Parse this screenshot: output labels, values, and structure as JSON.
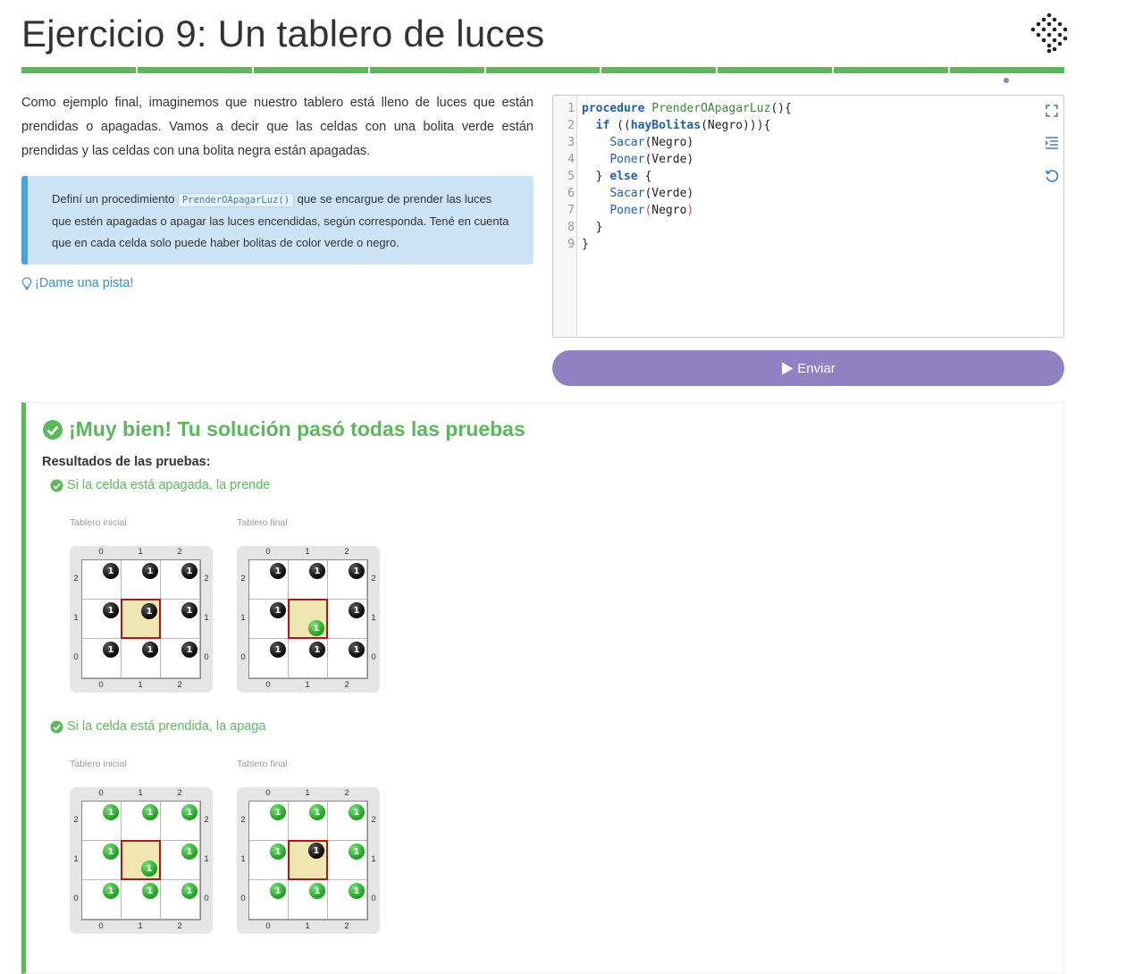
{
  "page": {
    "title": "Ejercicio 9: Un tablero de luces",
    "description": "Como ejemplo final, imaginemos que nuestro tablero está lleno de luces que están prendidas o apagadas. Vamos a decir que las celdas con una bolita verde están prendidas y las celdas con una bolita negra están apagadas.",
    "instructions": {
      "before": "Definí un procedimiento ",
      "code": "PrenderOApagarLuz()",
      "after": " que se encargue de prender las luces que estén apagadas o apagar las luces encendidas, según corresponda. Tené en cuenta que en cada celda solo puede haber bolitas de color verde o negro."
    },
    "hint_label": "¡Dame una pista!",
    "progress_segments": 9
  },
  "editor": {
    "lines": [
      "1",
      "2",
      "3",
      "4",
      "5",
      "6",
      "7",
      "8",
      "9"
    ],
    "tools": [
      "fullscreen-icon",
      "indent-icon",
      "reset-icon"
    ]
  },
  "submit_label": "Enviar",
  "results": {
    "title": "¡Muy bien! Tu solución pasó todas las pruebas",
    "label": "Resultados de las pruebas:",
    "tests": [
      {
        "name": "Si la celda está apagada, la prende",
        "initial_caption": "Tablero inicial",
        "final_caption": "Tablero final",
        "initial_board": [
          [
            "black",
            "black",
            "black"
          ],
          [
            "black",
            "black",
            "black"
          ],
          [
            "black",
            "black",
            "black"
          ]
        ],
        "final_board": [
          [
            "black",
            "black",
            "black"
          ],
          [
            "black",
            "green",
            "black"
          ],
          [
            "black",
            "black",
            "black"
          ]
        ]
      },
      {
        "name": "Si la celda está prendida, la apaga",
        "initial_caption": "Tablero inicial",
        "final_caption": "Tablero final",
        "initial_board": [
          [
            "green",
            "green",
            "green"
          ],
          [
            "green",
            "green",
            "green"
          ],
          [
            "green",
            "green",
            "green"
          ]
        ],
        "final_board": [
          [
            "green",
            "green",
            "green"
          ],
          [
            "green",
            "black",
            "green"
          ],
          [
            "green",
            "green",
            "green"
          ]
        ]
      }
    ],
    "ball_count": "1",
    "col_labels": [
      "0",
      "1",
      "2"
    ],
    "row_labels": [
      "2",
      "1",
      "0"
    ],
    "colors": {
      "success": "#5cb85c",
      "accent": "#9081c3",
      "black_ball": "#111111",
      "green_ball": "#2aab2a"
    }
  }
}
